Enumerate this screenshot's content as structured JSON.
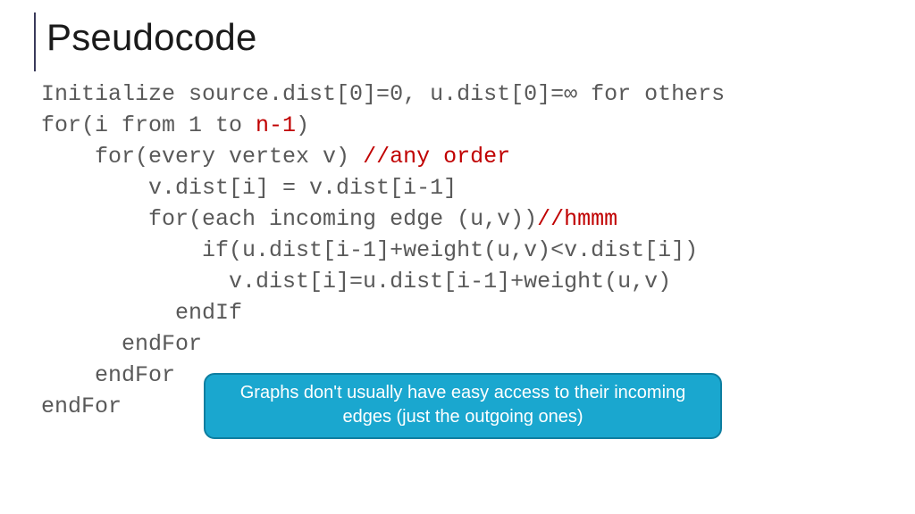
{
  "title": "Pseudocode",
  "code": {
    "l1": "Initialize source.dist[0]=0, u.dist[0]=∞ for others",
    "l2a": "for(i from 1 to ",
    "l2b": "n-1",
    "l2c": ")",
    "l3a": "    for(every vertex v) ",
    "l3b": "//any order",
    "l4": "        v.dist[i] = v.dist[i-1]",
    "l5a": "        for(each incoming edge (u,v))",
    "l5b": "//hmmm",
    "l6": "            if(u.dist[i-1]+weight(u,v)<v.dist[i])",
    "l7": "              v.dist[i]=u.dist[i-1]+weight(u,v)",
    "l8": "          endIf",
    "l9": "      endFor",
    "l10": "    endFor",
    "l11": "endFor"
  },
  "callout": "Graphs don't usually have easy access to their incoming edges (just the outgoing ones)"
}
